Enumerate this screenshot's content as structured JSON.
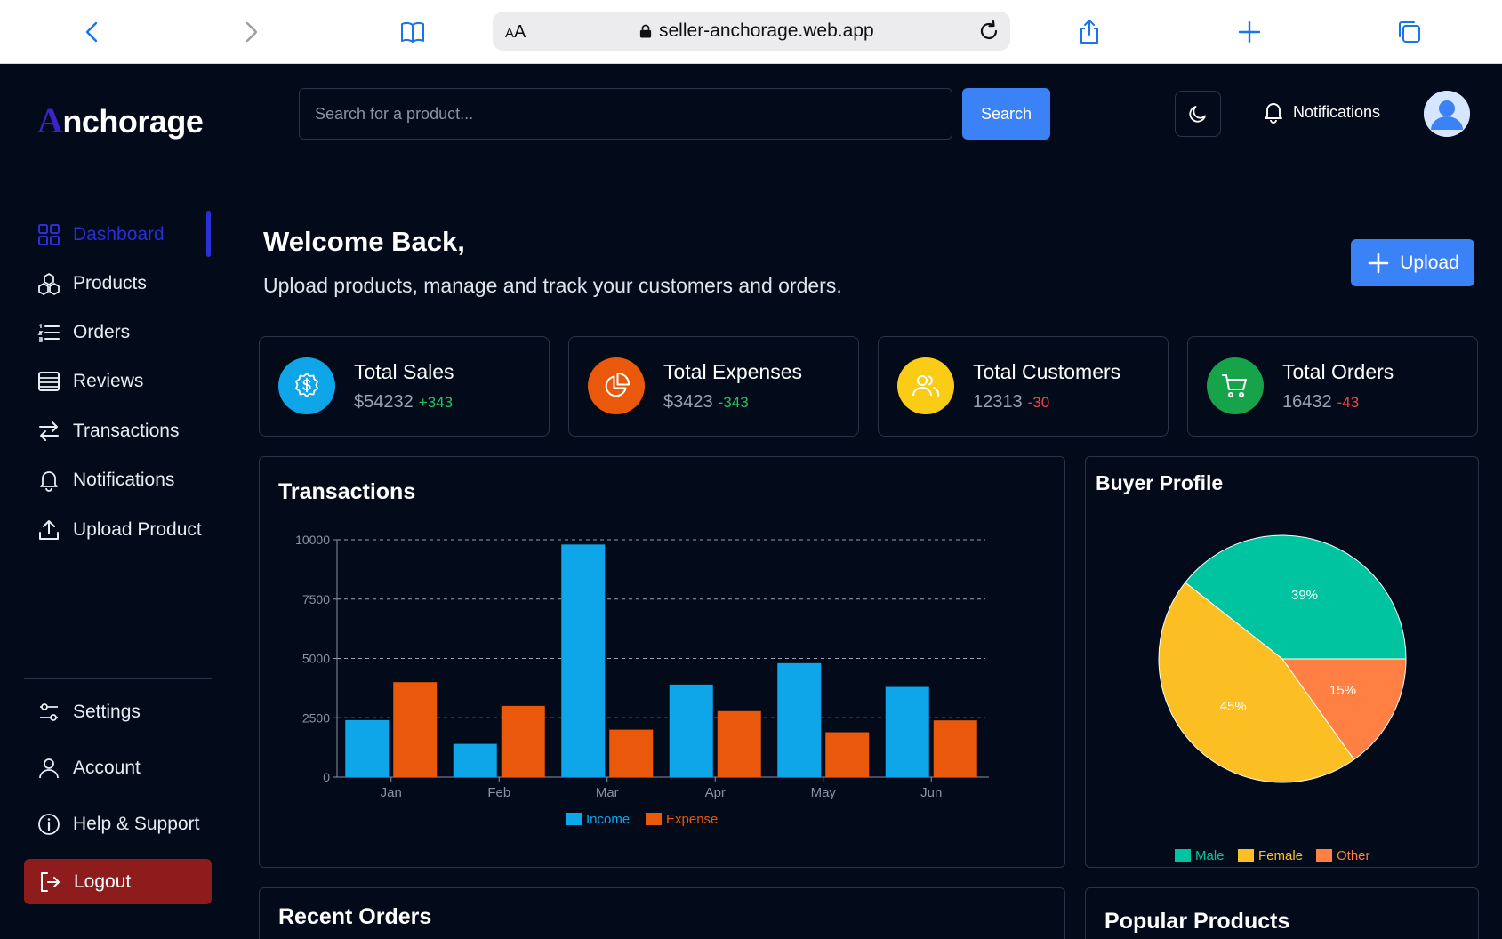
{
  "browser": {
    "aa_label_big": "A",
    "aa_label_small": "A",
    "url": "seller-anchorage.web.app"
  },
  "brand": {
    "logo_initial": "A",
    "logo_rest": "nchorage",
    "accent": "#2a2fd8"
  },
  "sidebar": {
    "items": [
      {
        "label": "Dashboard",
        "icon": "grid-icon"
      },
      {
        "label": "Products",
        "icon": "cubes-icon"
      },
      {
        "label": "Orders",
        "icon": "list-icon"
      },
      {
        "label": "Reviews",
        "icon": "table-icon"
      },
      {
        "label": "Transactions",
        "icon": "arrows-icon"
      },
      {
        "label": "Notifications",
        "icon": "bell-icon"
      },
      {
        "label": "Upload Product",
        "icon": "upload-icon"
      }
    ],
    "bottom_items": [
      {
        "label": "Settings",
        "icon": "sliders-icon"
      },
      {
        "label": "Account",
        "icon": "user-icon"
      },
      {
        "label": "Help & Support",
        "icon": "info-icon"
      }
    ],
    "logout_label": "Logout"
  },
  "topbar": {
    "search_placeholder": "Search for a product...",
    "search_button": "Search",
    "notifications_label": "Notifications"
  },
  "main": {
    "welcome": "Welcome Back,",
    "subtitle": "Upload products, manage and track your customers and orders.",
    "upload_label": "Upload"
  },
  "stats": [
    {
      "title": "Total Sales",
      "value": "$54232",
      "delta": "+343",
      "color": "#0ea5e9",
      "icon": "dollar-badge-icon"
    },
    {
      "title": "Total Expenses",
      "value": "$3423",
      "delta": "-343",
      "color": "#ea580c",
      "icon": "pie-icon"
    },
    {
      "title": "Total Customers",
      "value": "12313",
      "delta": "-30",
      "color": "#facc15",
      "icon": "users-icon"
    },
    {
      "title": "Total Orders",
      "value": "16432",
      "delta": "-43",
      "color": "#16a34a",
      "icon": "cart-icon"
    }
  ],
  "panels": {
    "transactions_title": "Transactions",
    "buyer_title": "Buyer Profile",
    "recent_orders_title": "Recent Orders",
    "popular_products_title": "Popular Products"
  },
  "chart_data": [
    {
      "type": "bar",
      "title": "Transactions",
      "categories": [
        "Jan",
        "Feb",
        "Mar",
        "Apr",
        "May",
        "Jun"
      ],
      "series": [
        {
          "name": "Income",
          "color": "#0ea5e9",
          "values": [
            2400,
            1400,
            9800,
            3900,
            4800,
            3800
          ]
        },
        {
          "name": "Expense",
          "color": "#ea580c",
          "values": [
            4000,
            3000,
            2000,
            2780,
            1890,
            2390
          ]
        }
      ],
      "yticks": [
        0,
        2500,
        5000,
        7500,
        10000
      ],
      "ylim": [
        0,
        10000
      ],
      "grid": true,
      "legend": "bottom"
    },
    {
      "type": "pie",
      "title": "Buyer Profile",
      "slices": [
        {
          "name": "Male",
          "value": 39,
          "label": "39%",
          "color": "#00c49f"
        },
        {
          "name": "Other",
          "value": 15,
          "label": "15%",
          "color": "#ff8042"
        },
        {
          "name": "Female",
          "value": 45,
          "label": "45%",
          "color": "#fbbf24"
        }
      ],
      "legend_order": [
        "Male",
        "Female",
        "Other"
      ],
      "legend": "bottom"
    }
  ]
}
